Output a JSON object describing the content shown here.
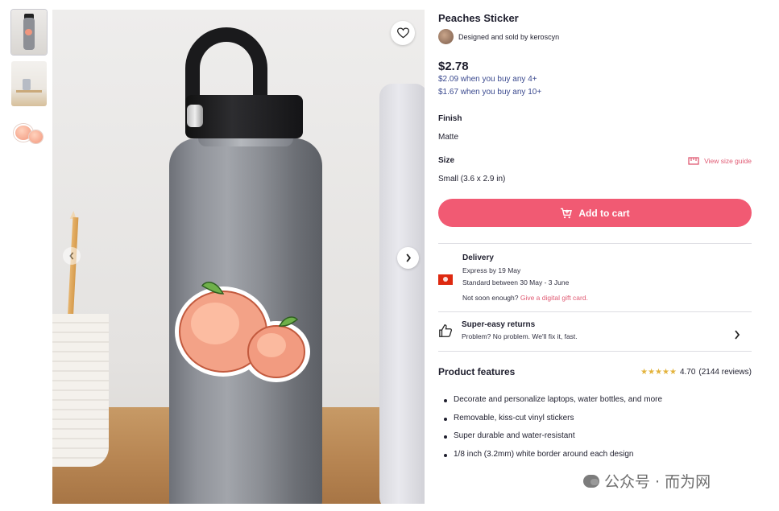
{
  "product": {
    "title": "Peaches Sticker",
    "seller_text": "Designed and sold by keroscyn",
    "price": "$2.78",
    "tiers": [
      "$2.09 when you buy any 4+",
      "$1.67 when you buy any 10+"
    ]
  },
  "options": {
    "finish_label": "Finish",
    "finish_value": "Matte",
    "size_label": "Size",
    "size_guide": "View size guide",
    "size_value": "Small (3.6 x 2.9 in)"
  },
  "cart": {
    "add_label": "Add to cart"
  },
  "delivery": {
    "title": "Delivery",
    "express": "Express by 19 May",
    "standard": "Standard between 30 May - 3 June",
    "gift_prefix": "Not soon enough? ",
    "gift_link": "Give a digital gift card."
  },
  "returns": {
    "title": "Super-easy returns",
    "subtitle": "Problem? No problem. We'll fix it, fast."
  },
  "features": {
    "title": "Product features",
    "rating": "4.70",
    "reviews": "(2144 reviews)",
    "stars": "★★★★★",
    "items": [
      "Decorate and personalize laptops, water bottles, and more",
      "Removable, kiss-cut vinyl stickers",
      "Super durable and water-resistant",
      "1/8 inch (3.2mm) white border around each design"
    ]
  },
  "watermark": {
    "text": "公众号 · 而为网"
  },
  "icons": {
    "heart": "heart-icon",
    "next": "chevron-right-icon",
    "prev": "chevron-left-icon",
    "cart": "cart-icon",
    "ruler": "ruler-icon",
    "thumb": "thumbs-up-icon",
    "flag": "hong-kong-flag-icon"
  },
  "colors": {
    "accent": "#f15a73",
    "link": "#3b4a8f",
    "star": "#e3b33c"
  }
}
